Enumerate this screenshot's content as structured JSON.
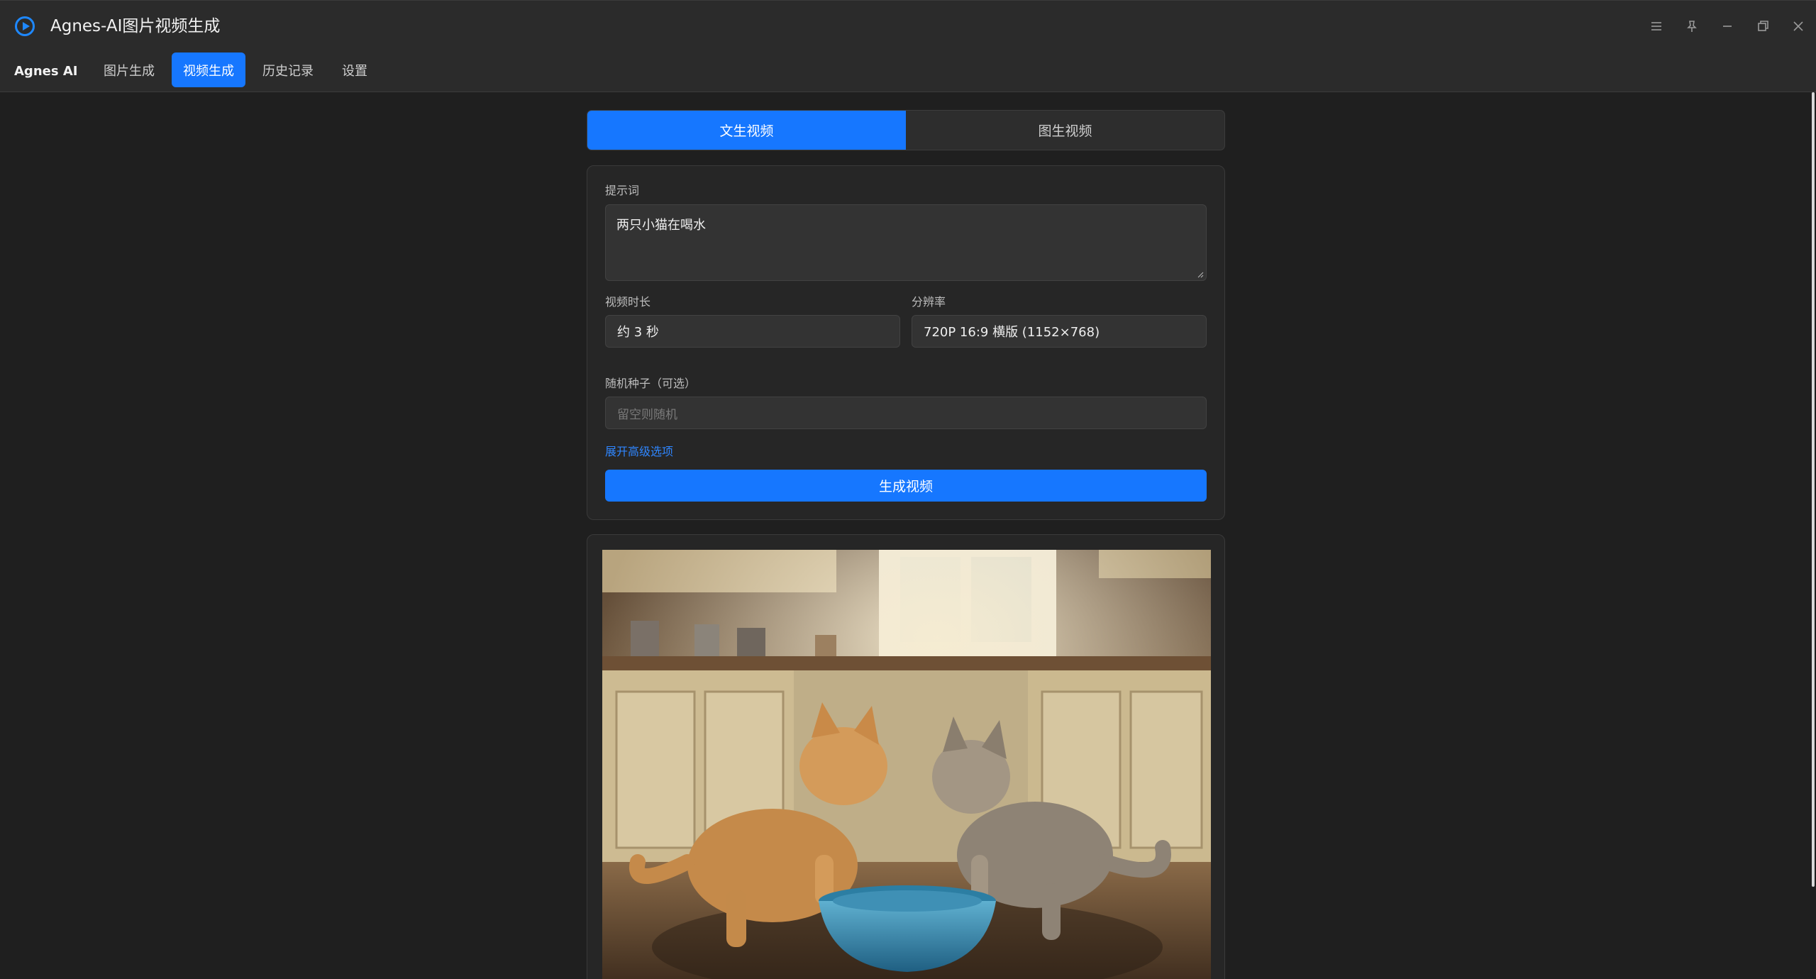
{
  "window": {
    "title": "Agnes-AI图片视频生成",
    "logo_icon": "play-circle-icon",
    "controls": [
      "menu-icon",
      "pin-icon",
      "minimize-icon",
      "restore-icon",
      "close-icon"
    ]
  },
  "menubar": {
    "brand": "Agnes AI",
    "items": [
      {
        "label": "图片生成",
        "active": false
      },
      {
        "label": "视频生成",
        "active": true
      },
      {
        "label": "历史记录",
        "active": false
      },
      {
        "label": "设置",
        "active": false
      }
    ]
  },
  "mode_tabs": [
    {
      "label": "文生视频",
      "active": true
    },
    {
      "label": "图生视频",
      "active": false
    }
  ],
  "form": {
    "prompt_label": "提示词",
    "prompt_value": "两只小猫在喝水",
    "duration_label": "视频时长",
    "duration_value": "约 3 秒",
    "resolution_label": "分辨率",
    "resolution_value": "720P 16:9 横版 (1152×768)",
    "seed_label": "随机种子（可选）",
    "seed_placeholder": "留空则随机",
    "advanced_link": "展开高级选项",
    "generate_button": "生成视频"
  },
  "colors": {
    "accent": "#1677ff",
    "background": "#1f1f1f",
    "card": "#262626",
    "input": "#333333"
  }
}
